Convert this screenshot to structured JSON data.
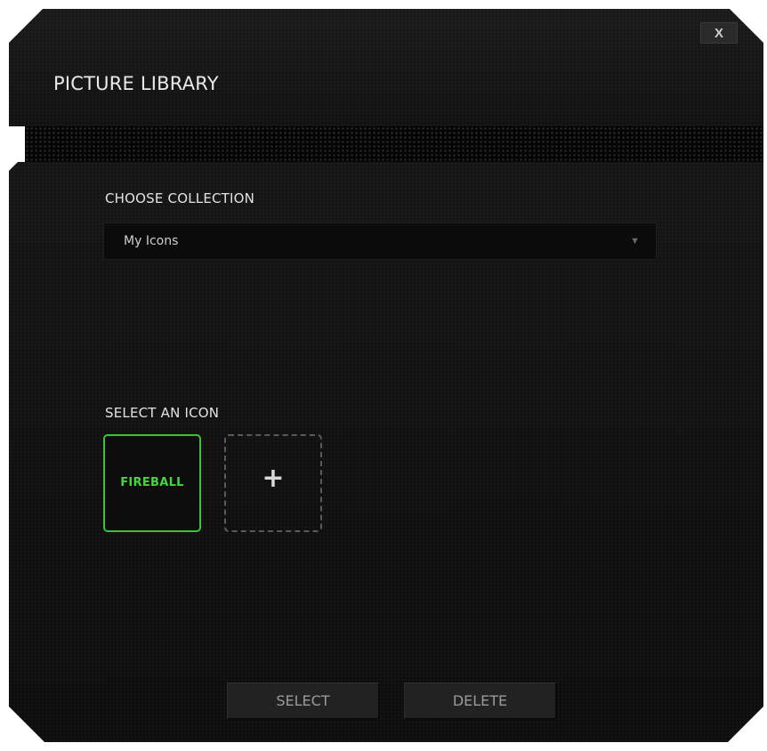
{
  "window": {
    "title": "PICTURE LIBRARY",
    "close_label": "X"
  },
  "collection": {
    "label": "CHOOSE COLLECTION",
    "selected": "My Icons",
    "arrow_icon": "triangle-down-icon"
  },
  "icons": {
    "label": "SELECT AN ICON",
    "items": [
      {
        "label": "FIREBALL",
        "selected": true
      }
    ],
    "add_label": "+"
  },
  "actions": {
    "select_label": "SELECT",
    "delete_label": "DELETE"
  },
  "colors": {
    "accent": "#44d83a",
    "background": "#121212"
  }
}
